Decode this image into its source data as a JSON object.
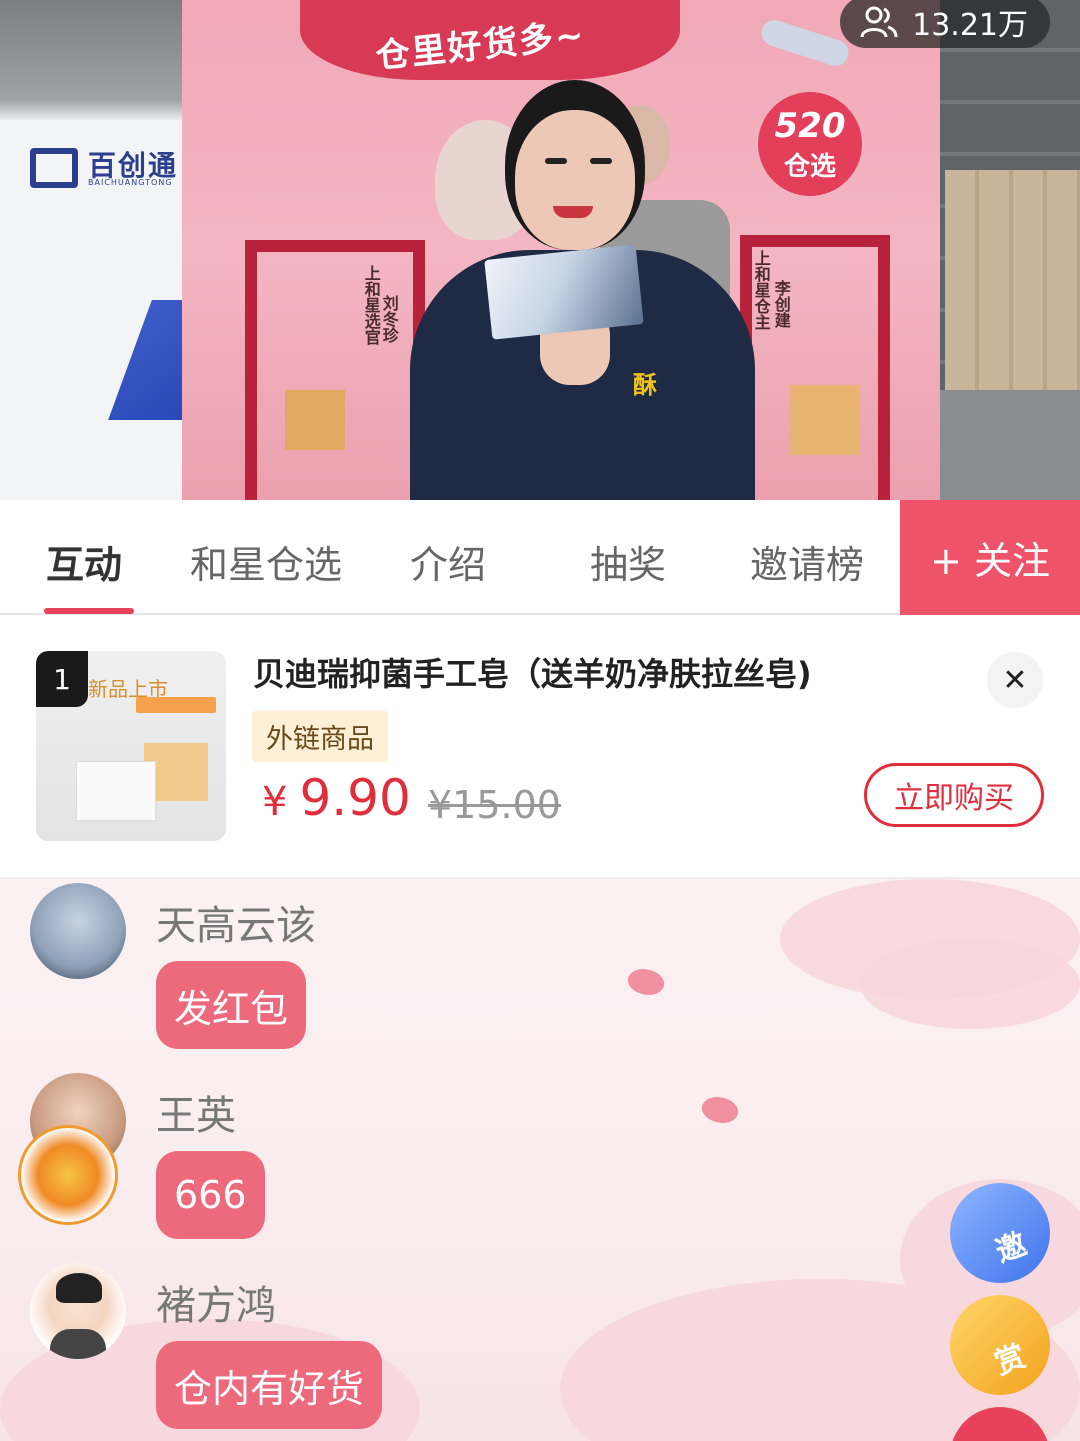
{
  "video": {
    "banner_text": "仓里好货多~",
    "brand_name": "百创通",
    "brand_sub": "BAICHUANGTONG",
    "badge_number": "520",
    "badge_text": "仓选",
    "poster_left_line1": "上和星选官",
    "poster_left_line2": "刘冬珍",
    "poster_right_line1": "上和星仓主",
    "poster_right_line2": "李创建",
    "shirt_logo": "酥",
    "viewer_count": "13.21万"
  },
  "tabs": {
    "items": [
      "互动",
      "和星仓选",
      "介绍",
      "抽奖",
      "邀请榜"
    ],
    "active_index": 0,
    "follow_label": "+ 关注"
  },
  "product": {
    "index": "1",
    "thumb_text": "新品上市",
    "title": "贝迪瑞抑菌手工皂（送羊奶净肤拉丝皂)",
    "badge": "外链商品",
    "currency": "¥",
    "price": "9.90",
    "original_price": "¥15.00",
    "buy_label": "立即购买",
    "close_icon": "close-icon"
  },
  "chat": {
    "messages": [
      {
        "user": "天高云该",
        "text": "发红包"
      },
      {
        "user": "王英",
        "text": "666"
      },
      {
        "user": "褚方鸿",
        "text": "仓内有好货"
      }
    ]
  },
  "side_buttons": {
    "invite_label": "邀",
    "reward_label": "赏"
  },
  "colors": {
    "accent": "#ee5369",
    "price": "#e02e3c",
    "bubble": "#ec6a7c"
  }
}
